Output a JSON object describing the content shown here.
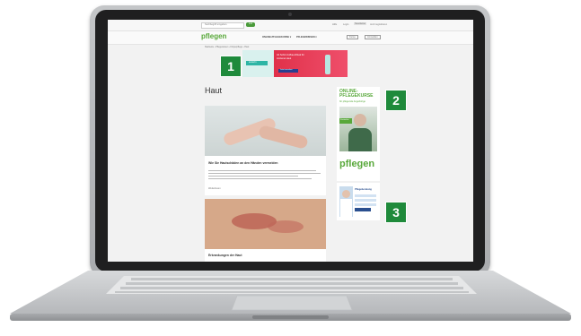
{
  "site": {
    "topbar": {
      "search_placeholder": "Suchbegriff eingeben",
      "search_button": "Los",
      "links": [
        "Hilfe",
        "Login",
        "Newsletter",
        "Jetzt registrieren"
      ]
    },
    "logo": "pflegen",
    "nav": {
      "items": [
        "ONLINE-PFLEGEKURSE ▾",
        "PFLEGEWISSEN ▾"
      ],
      "buttons": [
        "Kurse",
        "Anmelden"
      ]
    },
    "breadcrumb": "Startseite › Pflegewissen › Körperpflege › Haut",
    "page_title": "Haut",
    "articles": [
      {
        "title": "Wie Sie Hautschäden an den Händen vermeiden",
        "more": "Weiterlesen"
      },
      {
        "title": "Erkrankungen der Haut"
      }
    ],
    "ad_banner": {
      "headline": "Ab Sofort Aufbau-Ritual für trockene Haut",
      "cta": "Jetzt ansehen",
      "brand": "eucerin"
    },
    "sidebar_ad": {
      "headline": "ONLINE-PFLEGEKURSE",
      "sub": "für pflegende Angehörige",
      "tag": "Kostenlos",
      "logo": "pflegen"
    },
    "sidebar_ad2": {
      "headline": "Pflegeberatung"
    }
  },
  "badges": [
    "1",
    "2",
    "3"
  ],
  "colors": {
    "accent_green": "#1f8a3b",
    "brand_green": "#58a83a",
    "ad_red": "#e0314a",
    "ad_teal": "#2db5a5"
  }
}
